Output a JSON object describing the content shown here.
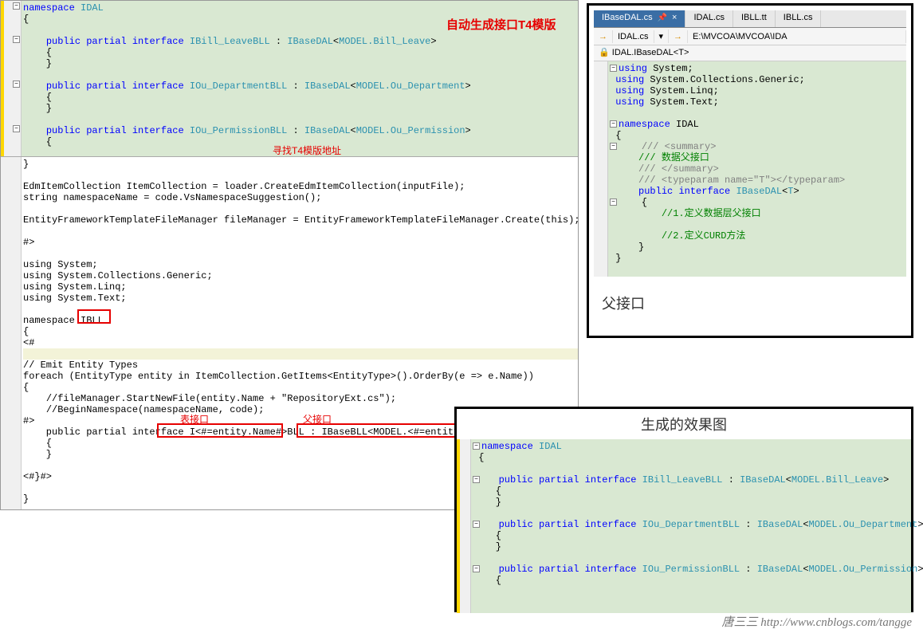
{
  "annotations": {
    "auto_gen_label": "自动生成接口T4模版",
    "find_t4_addr": "寻找T4模版地址",
    "table_iface": "表接口",
    "parent_iface": "父接口",
    "parent_label": "父接口",
    "effect_title": "生成的效果图"
  },
  "tabs": [
    {
      "label": "IBaseDAL.cs",
      "active": true
    },
    {
      "label": "IDAL.cs",
      "active": false
    },
    {
      "label": "IBLL.tt",
      "active": false
    },
    {
      "label": "IBLL.cs",
      "active": false
    }
  ],
  "nav": {
    "project": "IDAL.cs",
    "path": "E:\\MVCOA\\MVCOA\\IDA"
  },
  "member": "IDAL.IBaseDAL<T>",
  "main_code": {
    "ns": "namespace",
    "ns_name": "IDAL",
    "pub": "public",
    "partial": "partial",
    "iface": "interface",
    "i1": "IBill_LeaveBLL",
    "b1": "IBaseDAL",
    "m1": "MODEL.Bill_Leave",
    "i2": "IOu_DepartmentBLL",
    "m2": "MODEL.Ou_Department",
    "i3": "IOu_PermissionBLL",
    "m3": "MODEL.Ou_Permission"
  },
  "t4_code": {
    "l1": "EdmItemCollection ItemCollection = loader.CreateEdmItemCollection(inputFile);",
    "l2": "string namespaceName = code.VsNamespaceSuggestion();",
    "l3": "EntityFrameworkTemplateFileManager fileManager = EntityFrameworkTemplateFileManager.Create(this);",
    "l4": "#>",
    "u1": "using System;",
    "u2": "using System.Collections.Generic;",
    "u3": "using System.Linq;",
    "u4": "using System.Text;",
    "ns": "namespace ",
    "ns_name": "IBLL",
    "c1": "// Emit Entity Types",
    "fe": "foreach (EntityType entity in ItemCollection.GetItems<EntityType>().OrderBy(e => e.Name))",
    "c2": "//fileManager.StartNewFile(entity.Name + \"RepositoryExt.cs\");",
    "c3": "//BeginNamespace(namespaceName, code);",
    "tpl1": "I<#=entity.Name#>BLL",
    "tpl2": "IBaseBLL<MODEL.<#=entity.Name#>>",
    "end": "<#}#>"
  },
  "right_code": {
    "u1": "using",
    "s1": "System",
    "s2": "System.Collections.Generic",
    "s3": "System.Linq",
    "s4": "System.Text",
    "ns": "namespace",
    "ns_name": "IDAL",
    "c1": "/// <summary>",
    "c2": "/// 数据父接口",
    "c3": "/// </summary>",
    "c4": "/// <typeparam name=\"T\"></typeparam>",
    "pub": "public",
    "iface": "interface",
    "name": "IBaseDAL",
    "tp": "T",
    "cm1": "//1.定义数据层父接口",
    "cm2": "//2.定义CURD方法"
  },
  "bottom_code": {
    "ns": "namespace",
    "ns_name": "IDAL",
    "pub": "public",
    "partial": "partial",
    "iface": "interface",
    "i1": "IBill_LeaveBLL",
    "b": "IBaseDAL",
    "m1": "MODEL.Bill_Leave",
    "i2": "IOu_DepartmentBLL",
    "m2": "MODEL.Ou_Department",
    "i3": "IOu_PermissionBLL",
    "m3": "MODEL.Ou_Permission"
  },
  "watermark": {
    "name": "唐三三",
    "url": "http://www.cnblogs.com/tangge"
  }
}
